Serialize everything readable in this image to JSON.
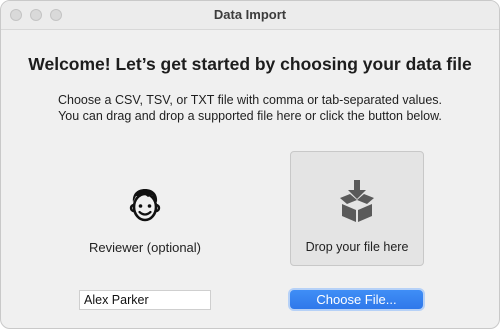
{
  "window": {
    "title": "Data Import"
  },
  "content": {
    "headline": "Welcome! Let’s get started by choosing your data file",
    "description_line1": "Choose a CSV, TSV, or TXT file with comma or tab-separated values.",
    "description_line2": "You can drag and drop a supported file here or click the button below."
  },
  "reviewer": {
    "icon": "face-icon",
    "label": "Reviewer (optional)",
    "value": "Alex Parker"
  },
  "drop_zone": {
    "icon": "download-box-icon",
    "label": "Drop your file here"
  },
  "choose_button": {
    "label": "Choose File..."
  },
  "colors": {
    "accent": "#2f7cf0",
    "window_bg": "#f0f0f0",
    "drop_zone_bg": "#e4e4e4"
  }
}
